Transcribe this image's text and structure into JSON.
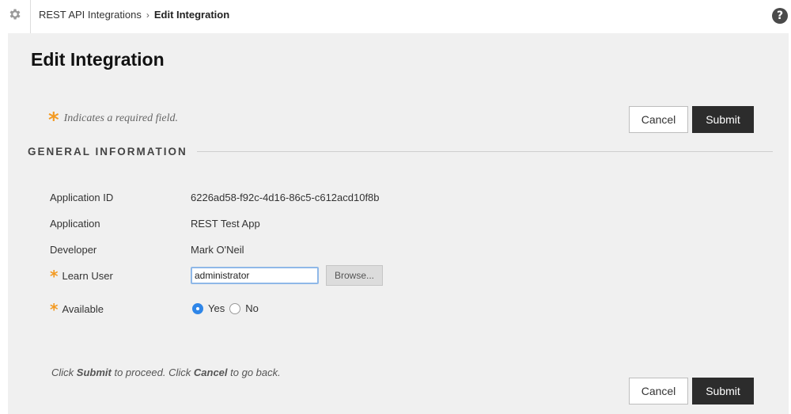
{
  "breadcrumb": {
    "parent": "REST API Integrations",
    "separator": "›",
    "current": "Edit Integration"
  },
  "help": {
    "label": "?"
  },
  "page": {
    "title": "Edit Integration"
  },
  "required_note": {
    "star": "*",
    "text": "Indicates a required field."
  },
  "buttons": {
    "cancel": "Cancel",
    "submit": "Submit"
  },
  "section": {
    "title": "GENERAL INFORMATION"
  },
  "fields": {
    "application_id": {
      "label": "Application ID",
      "value": "6226ad58-f92c-4d16-86c5-c612acd10f8b"
    },
    "application": {
      "label": "Application",
      "value": "REST Test App"
    },
    "developer": {
      "label": "Developer",
      "value": "Mark O'Neil"
    },
    "learn_user": {
      "label": "Learn User",
      "value": "administrator",
      "browse": "Browse..."
    },
    "available": {
      "label": "Available",
      "options": [
        "Yes",
        "No"
      ],
      "selected": "Yes"
    }
  },
  "footer": {
    "part1": "Click ",
    "submit_word": "Submit",
    "part2": " to proceed. Click ",
    "cancel_word": "Cancel",
    "part3": " to go back."
  },
  "colors": {
    "accent_star": "#f39a22",
    "submit_bg": "#2c2c2c",
    "radio_selected": "#2f86e8",
    "panel_bg": "#f0f0f0"
  },
  "icons": {
    "settings": "gear-icon",
    "help": "help-icon"
  }
}
